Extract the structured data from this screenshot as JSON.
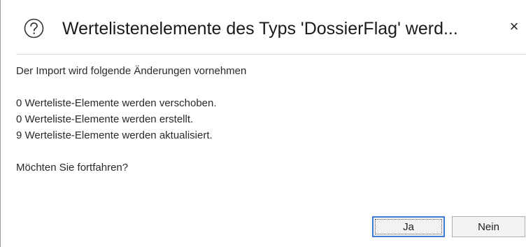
{
  "dialog": {
    "title": "Wertelistenelemente des Typs 'DossierFlag' werd...",
    "close_label": "×",
    "icon": "question-circle-icon"
  },
  "body": {
    "intro": "Der Import wird folgende Änderungen vornehmen",
    "changes": [
      "0 Werteliste-Elemente werden verschoben.",
      "0 Werteliste-Elemente werden erstellt.",
      "9 Werteliste-Elemente werden aktualisiert."
    ],
    "question": "Möchten Sie fortfahren?"
  },
  "buttons": {
    "yes_label": "Ja",
    "no_label": "Nein"
  },
  "colors": {
    "focus_border": "#3c7fd1",
    "button_background": "#f3f3f3",
    "divider": "#dcdcdc"
  }
}
